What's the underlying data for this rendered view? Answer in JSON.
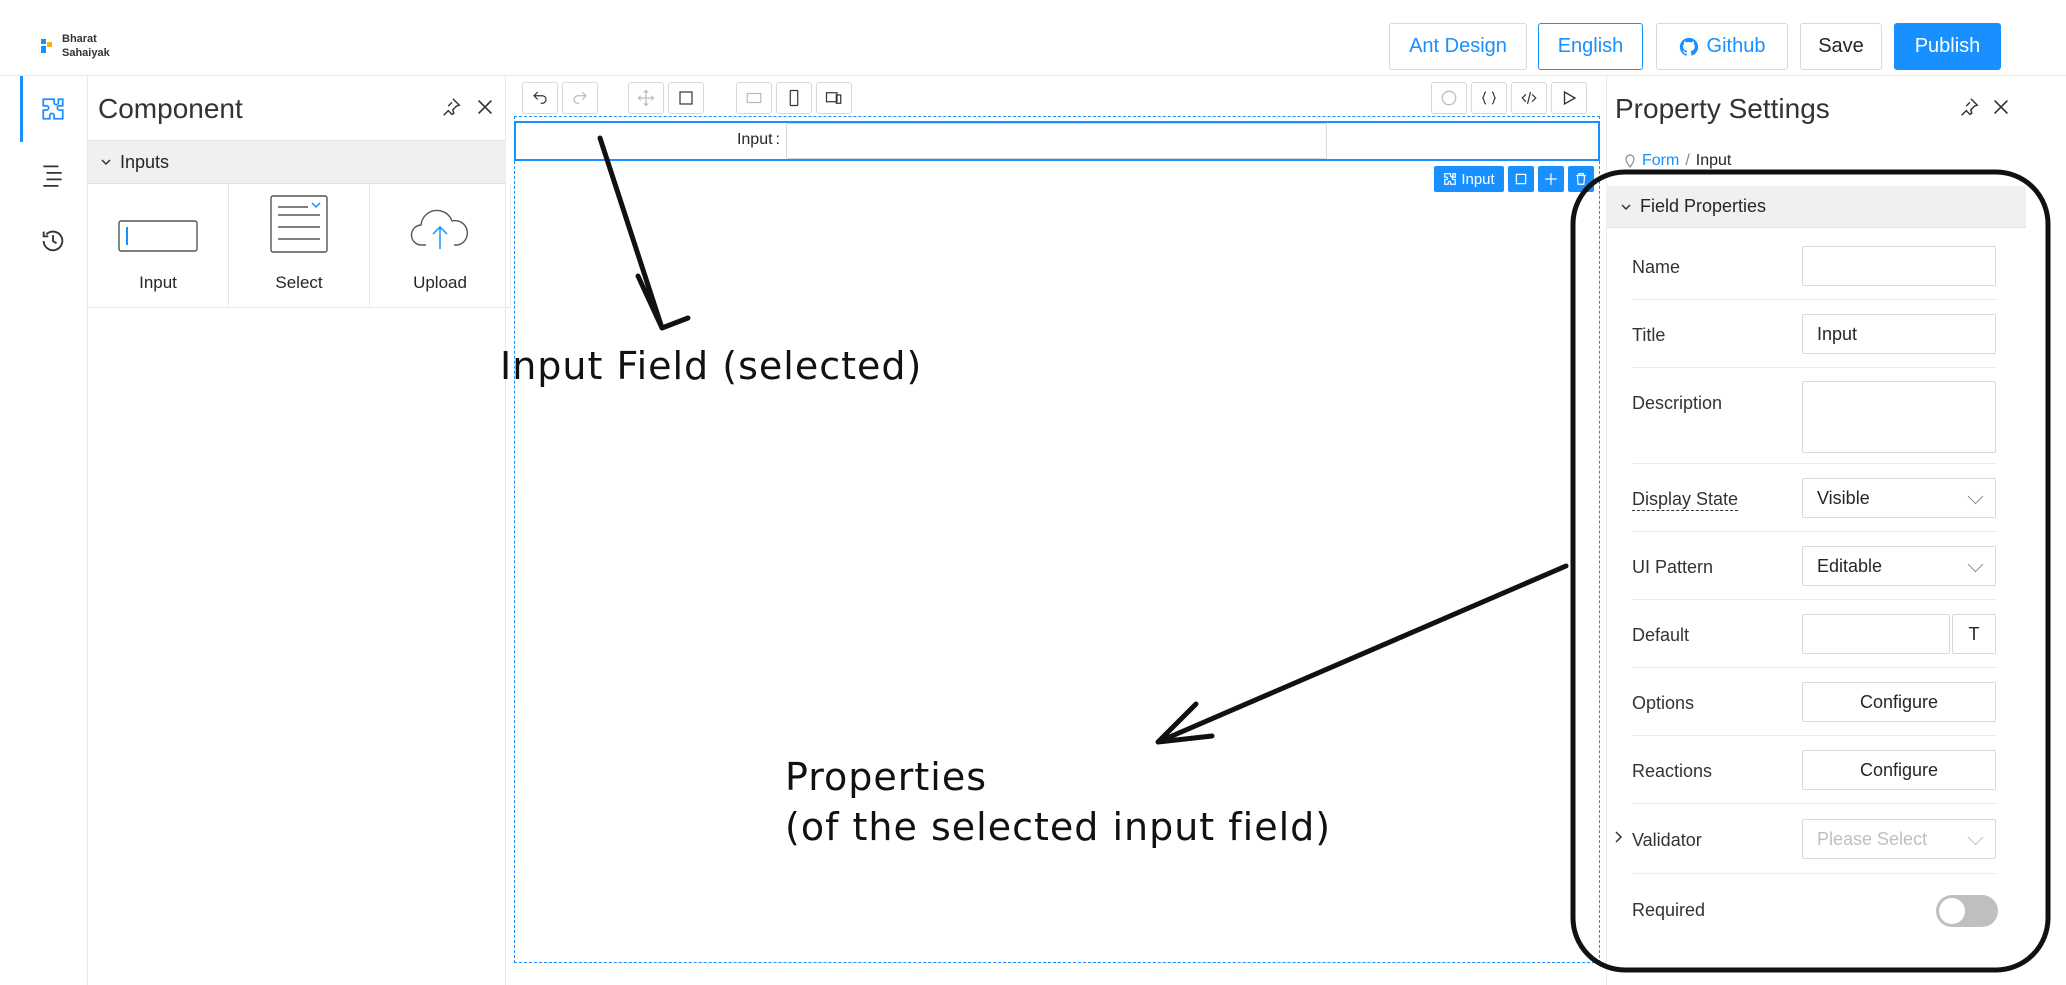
{
  "logo": {
    "line1": "Bharat",
    "line2": "Sahaiyak"
  },
  "header": {
    "buttons": [
      {
        "label": "Ant Design",
        "icon": ""
      },
      {
        "label": "English",
        "icon": ""
      },
      {
        "label": "Github",
        "icon": "github-icon"
      },
      {
        "label": "Save",
        "icon": ""
      },
      {
        "label": "Publish",
        "icon": ""
      }
    ]
  },
  "rail": {
    "icons": [
      "component-icon",
      "outline-tree-icon",
      "history-icon"
    ]
  },
  "component_panel": {
    "title": "Component",
    "group": "Inputs",
    "items": [
      {
        "label": "Input",
        "icon": "input-icon"
      },
      {
        "label": "Select",
        "icon": "select-icon"
      },
      {
        "label": "Upload",
        "icon": "upload-icon"
      }
    ]
  },
  "canvas": {
    "field_label": "Input",
    "field_label_colon": ":",
    "selection_tag": "Input"
  },
  "property_panel": {
    "title": "Property Settings",
    "breadcrumb_form": "Form",
    "breadcrumb_sep": "/",
    "breadcrumb_current": "Input",
    "section": "Field Properties",
    "rows": {
      "name": {
        "label": "Name",
        "value": ""
      },
      "title": {
        "label": "Title",
        "value": "Input"
      },
      "description": {
        "label": "Description",
        "value": ""
      },
      "display_state": {
        "label": "Display State",
        "value": "Visible"
      },
      "ui_pattern": {
        "label": "UI Pattern",
        "value": "Editable"
      },
      "default": {
        "label": "Default",
        "value": "",
        "type_btn": "T"
      },
      "options": {
        "label": "Options",
        "button": "Configure"
      },
      "reactions": {
        "label": "Reactions",
        "button": "Configure"
      },
      "validator": {
        "label": "Validator",
        "placeholder": "Please Select"
      },
      "required": {
        "label": "Required",
        "on": false
      }
    }
  },
  "annotations": {
    "input_field": "Input Field (selected)",
    "properties_line1": "Properties",
    "properties_line2": "(of the selected input field)"
  },
  "colors": {
    "accent": "#1890ff",
    "border": "#d9d9d9",
    "header_bg": "#f0f0f0"
  }
}
